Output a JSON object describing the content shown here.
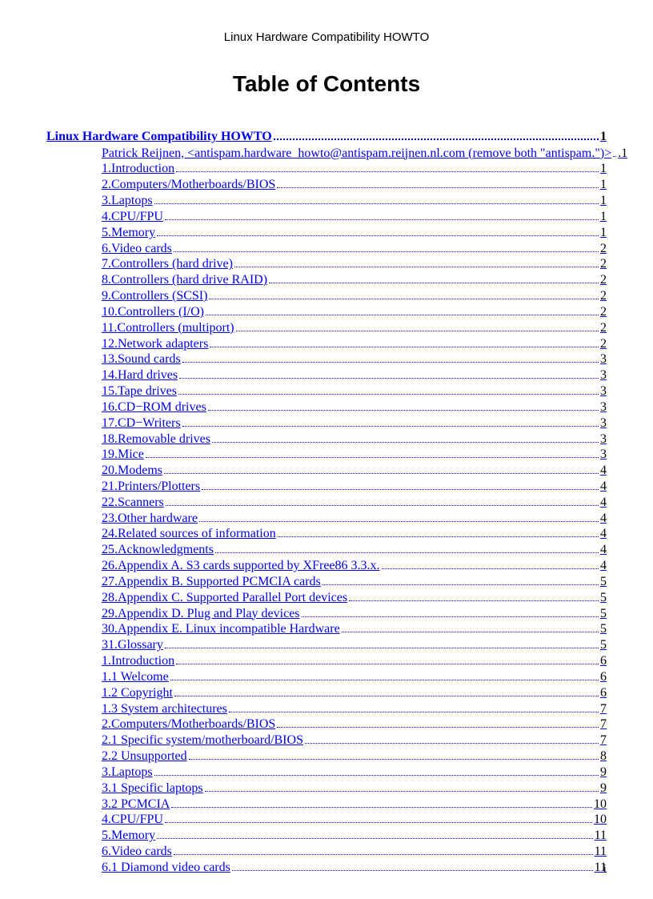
{
  "header": "Linux Hardware Compatibility HOWTO",
  "title": "Table of Contents",
  "main_entry": {
    "label": "Linux Hardware Compatibility HOWTO",
    "page": "1"
  },
  "entries": [
    {
      "label": "Patrick Reijnen, <antispam.hardware_howto@antispam.reijnen.nl.com (remove both \"antispam.\")>",
      "page": ".1"
    },
    {
      "label": "1.Introduction",
      "page": "1"
    },
    {
      "label": "2.Computers/Motherboards/BIOS",
      "page": "1"
    },
    {
      "label": "3.Laptops",
      "page": "1"
    },
    {
      "label": "4.CPU/FPU",
      "page": "1"
    },
    {
      "label": "5.Memory",
      "page": "1"
    },
    {
      "label": "6.Video cards",
      "page": "2"
    },
    {
      "label": "7.Controllers (hard drive)",
      "page": "2"
    },
    {
      "label": "8.Controllers (hard drive RAID)",
      "page": "2"
    },
    {
      "label": "9.Controllers (SCSI)",
      "page": "2"
    },
    {
      "label": "10.Controllers (I/O)",
      "page": "2"
    },
    {
      "label": "11.Controllers (multiport)",
      "page": "2"
    },
    {
      "label": "12.Network adapters",
      "page": "2"
    },
    {
      "label": "13.Sound cards",
      "page": "3"
    },
    {
      "label": "14.Hard drives",
      "page": "3"
    },
    {
      "label": "15.Tape drives",
      "page": "3"
    },
    {
      "label": "16.CD−ROM drives",
      "page": "3"
    },
    {
      "label": "17.CD−Writers",
      "page": "3"
    },
    {
      "label": "18.Removable drives",
      "page": "3"
    },
    {
      "label": "19.Mice",
      "page": "3"
    },
    {
      "label": "20.Modems",
      "page": "4"
    },
    {
      "label": "21.Printers/Plotters",
      "page": "4"
    },
    {
      "label": "22.Scanners",
      "page": "4"
    },
    {
      "label": "23.Other hardware",
      "page": "4"
    },
    {
      "label": "24.Related sources of information",
      "page": "4"
    },
    {
      "label": "25.Acknowledgments",
      "page": "4"
    },
    {
      "label": "26.Appendix A. S3 cards supported by XFree86 3.3.x.",
      "page": "4"
    },
    {
      "label": "27.Appendix B. Supported PCMCIA cards",
      "page": "5"
    },
    {
      "label": "28.Appendix C. Supported Parallel Port devices",
      "page": "5"
    },
    {
      "label": "29.Appendix D. Plug and Play devices",
      "page": "5"
    },
    {
      "label": "30.Appendix E. Linux incompatible Hardware",
      "page": "5"
    },
    {
      "label": "31.Glossary",
      "page": "5"
    },
    {
      "label": "1.Introduction",
      "page": "6"
    },
    {
      "label": "1.1 Welcome",
      "page": "6"
    },
    {
      "label": "1.2 Copyright",
      "page": "6"
    },
    {
      "label": "1.3 System architectures",
      "page": "7"
    },
    {
      "label": "2.Computers/Motherboards/BIOS",
      "page": "7"
    },
    {
      "label": "2.1 Specific system/motherboard/BIOS",
      "page": "7"
    },
    {
      "label": "2.2 Unsupported",
      "page": "8"
    },
    {
      "label": "3.Laptops",
      "page": "9"
    },
    {
      "label": "3.1 Specific laptops",
      "page": "9"
    },
    {
      "label": "3.2 PCMCIA",
      "page": "10"
    },
    {
      "label": "4.CPU/FPU",
      "page": "10"
    },
    {
      "label": "5.Memory",
      "page": "11"
    },
    {
      "label": "6.Video cards",
      "page": "11"
    },
    {
      "label": "6.1 Diamond video cards",
      "page": "11"
    }
  ],
  "page_number": "i"
}
